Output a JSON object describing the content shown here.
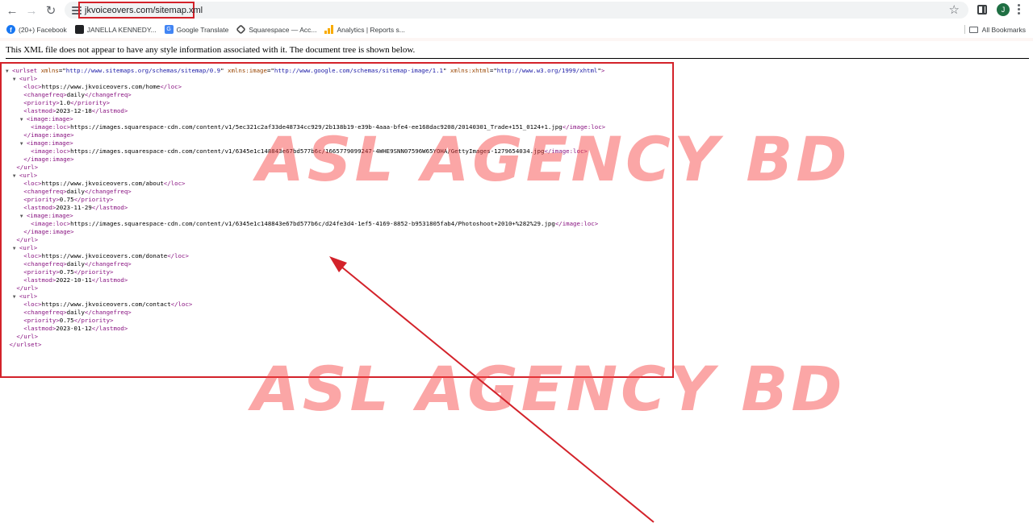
{
  "browser": {
    "url": "jkvoiceovers.com/sitemap.xml",
    "avatar_initial": "J",
    "accent": "#d3222a"
  },
  "bookmarks": {
    "items": [
      {
        "label": "(20+) Facebook",
        "icon": "facebook-icon"
      },
      {
        "label": "JANELLA KENNEDY...",
        "icon": "cube-icon"
      },
      {
        "label": "Google Translate",
        "icon": "google-translate-icon"
      },
      {
        "label": "Squarespace — Acc...",
        "icon": "squarespace-icon"
      },
      {
        "label": "Analytics | Reports s...",
        "icon": "analytics-icon"
      }
    ],
    "all_label": "All Bookmarks"
  },
  "xml": {
    "header": "This XML file does not appear to have any style information associated with it. The document tree is shown below.",
    "root_attrs": {
      "xmlns": "http://www.sitemaps.org/schemas/sitemap/0.9",
      "xmlns_image": "http://www.google.com/schemas/sitemap-image/1.1",
      "xmlns_xhtml": "http://www.w3.org/1999/xhtml"
    },
    "urls": [
      {
        "loc": "https://www.jkvoiceovers.com/home",
        "changefreq": "daily",
        "priority": "1.0",
        "lastmod": "2023-12-18",
        "images": [
          "https://images.squarespace-cdn.com/content/v1/5ec321c2af33de48734cc929/2b138b19-e39b-4aaa-bfe4-ee168dac9208/20140301_Trade+151_0124+1.jpg",
          "https://images.squarespace-cdn.com/content/v1/6345e1c148843e67bd577b6c/1665779099247-4WHE9SNN07596W65YOHA/GettyImages-1279654034.jpg"
        ]
      },
      {
        "loc": "https://www.jkvoiceovers.com/about",
        "changefreq": "daily",
        "priority": "0.75",
        "lastmod": "2023-11-29",
        "images": [
          "https://images.squarespace-cdn.com/content/v1/6345e1c148843e67bd577b6c/d24fe3d4-1ef5-4169-8852-b9531805fab4/Photoshoot+2010+%282%29.jpg"
        ]
      },
      {
        "loc": "https://www.jkvoiceovers.com/donate",
        "changefreq": "daily",
        "priority": "0.75",
        "lastmod": "2022-10-11",
        "images": []
      },
      {
        "loc": "https://www.jkvoiceovers.com/contact",
        "changefreq": "daily",
        "priority": "0.75",
        "lastmod": "2023-01-12",
        "images": []
      }
    ]
  },
  "watermark": {
    "text": "ASL AGENCY BD",
    "color": "#f64646"
  }
}
